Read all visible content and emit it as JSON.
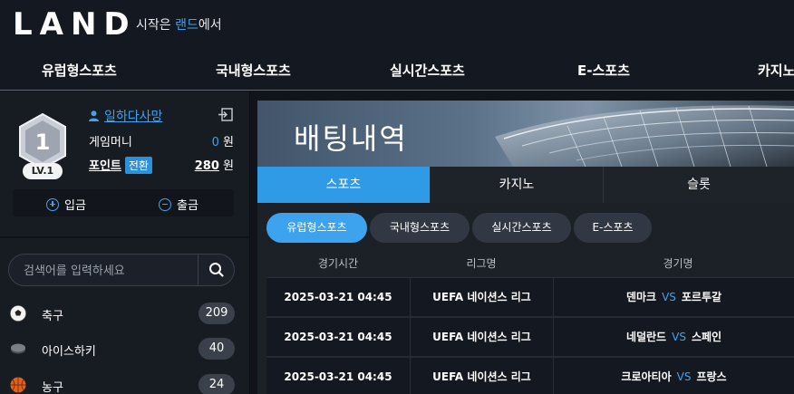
{
  "brand": {
    "logo_text": "LAND",
    "tagline_prefix": "시작은 ",
    "tagline_accent": "랜드",
    "tagline_suffix": "에서",
    "accent_color": "#3ea3ee"
  },
  "main_nav": [
    "유럽형스포츠",
    "국내형스포츠",
    "실시간스포츠",
    "E-스포츠",
    "카지노"
  ],
  "profile": {
    "level_number": "1",
    "level_label": "LV.1",
    "username": "일하다사망",
    "game_money_label": "게임머니",
    "game_money_value": "0",
    "money_unit": "원",
    "points_label": "포인트",
    "convert_label": "전환",
    "points_value": "280",
    "points_unit": "원",
    "deposit_label": "입금",
    "withdraw_label": "출금"
  },
  "search": {
    "placeholder": "검색어를 입력하세요"
  },
  "sports": [
    {
      "label": "축구",
      "count": "209",
      "icon": "soccer-ball-icon"
    },
    {
      "label": "아이스하키",
      "count": "40",
      "icon": "hockey-puck-icon"
    },
    {
      "label": "농구",
      "count": "24",
      "icon": "basketball-icon"
    }
  ],
  "content": {
    "banner_title": "배팅내역",
    "tabs": [
      "스포츠",
      "카지노",
      "슬롯"
    ],
    "active_tab": 0,
    "subtabs": [
      "유럽형스포츠",
      "국내형스포츠",
      "실시간스포츠",
      "E-스포츠"
    ],
    "active_subtab": 0,
    "table_headers": [
      "경기시간",
      "리그명",
      "경기명"
    ],
    "rows": [
      {
        "time": "2025-03-21 04:45",
        "league": "UEFA 네이션스 리그",
        "home": "덴마크",
        "vs": "VS",
        "away": "포르투갈"
      },
      {
        "time": "2025-03-21 04:45",
        "league": "UEFA 네이션스 리그",
        "home": "네덜란드",
        "vs": "VS",
        "away": "스페인"
      },
      {
        "time": "2025-03-21 04:45",
        "league": "UEFA 네이션스 리그",
        "home": "크로아티아",
        "vs": "VS",
        "away": "프랑스"
      }
    ]
  }
}
